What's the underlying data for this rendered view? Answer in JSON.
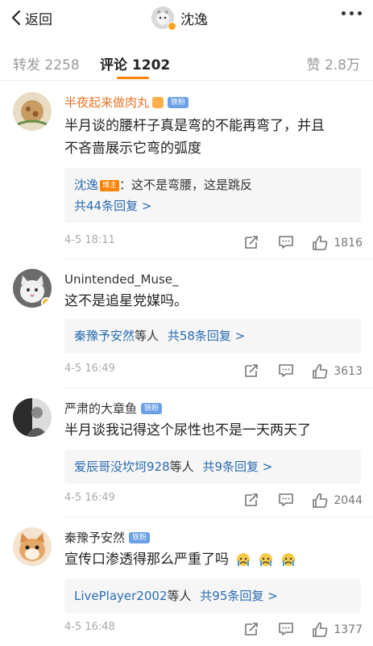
{
  "header": {
    "back_label": "返回",
    "title": "沈逸"
  },
  "tabs": {
    "repost_label": "转发 2258",
    "comments_label": "评论 1202",
    "likes_label": "赞 2.8万"
  },
  "comments": [
    {
      "username": "半夜起来做肉丸",
      "fan_badge": "铁粉",
      "text_line1": "半月谈的腰杆子真是弯的不能再弯了，并且",
      "text_line2": "不吝啬展示它弯的弧度",
      "reply": {
        "author": "沈逸",
        "author_badge": "博主",
        "text": "：这不是弯腰，这是跳反",
        "count": "共44条回复 >"
      },
      "time": "4-5 18:11",
      "likes": "1816"
    },
    {
      "username": "Unintended_Muse_",
      "text": "这不是追星党媒吗。",
      "reply_summary": {
        "names": "秦豫予安然",
        "suffix": "等人",
        "count": "共58条回复 >"
      },
      "time": "4-5 16:49",
      "likes": "3613"
    },
    {
      "username": "严肃的大章鱼",
      "fan_badge": "铁粉",
      "text": "半月谈我记得这个尿性也不是一天两天了",
      "reply_summary": {
        "names": "爱辰哥没坎坷928",
        "suffix": "等人",
        "count": "共9条回复 >"
      },
      "time": "4-5 16:49",
      "likes": "2044"
    },
    {
      "username": "秦豫予安然",
      "fan_badge": "铁粉",
      "text": "宣传口渗透得那么严重了吗",
      "reply_summary": {
        "names": "LivePlayer2002",
        "suffix": "等人",
        "count": "共95条回复 >"
      },
      "time": "4-5 16:48",
      "likes": "1377"
    }
  ],
  "colors": {
    "accent": "#ff8200",
    "link": "#2b6cb0",
    "fan_badge": "#6ba0e7"
  }
}
